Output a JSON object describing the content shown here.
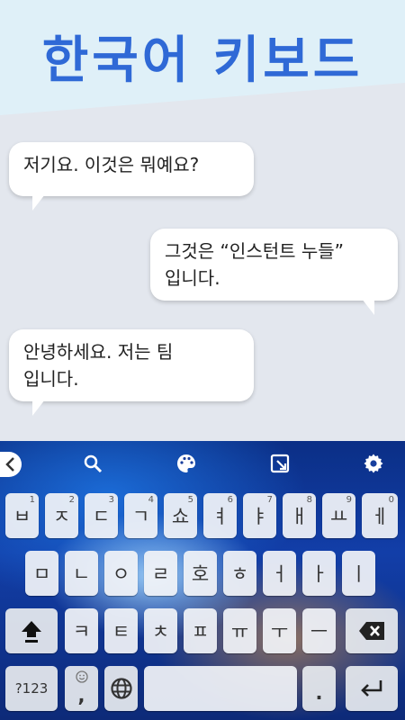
{
  "banner": {
    "title": "한국어 키보드"
  },
  "chat": {
    "messages": [
      {
        "line1": "저기요. 이것은 뭐예요?",
        "line2": ""
      },
      {
        "line1": "그것은 “인스턴트 누들”",
        "line2": "입니다."
      },
      {
        "line1": "안녕하세요. 저는 팀",
        "line2": "입니다."
      }
    ]
  },
  "toolbar": {
    "icons": [
      "back-chevron-icon",
      "search-icon",
      "palette-icon",
      "resize-icon",
      "gear-icon"
    ]
  },
  "keyboard": {
    "row1": [
      {
        "label": "ㅂ",
        "num": "1"
      },
      {
        "label": "ㅈ",
        "num": "2"
      },
      {
        "label": "ㄷ",
        "num": "3"
      },
      {
        "label": "ㄱ",
        "num": "4"
      },
      {
        "label": "쇼",
        "num": "5"
      },
      {
        "label": "ㅕ",
        "num": "6"
      },
      {
        "label": "ㅑ",
        "num": "7"
      },
      {
        "label": "ㅐ",
        "num": "8"
      },
      {
        "label": "ㅛ",
        "num": "9"
      },
      {
        "label": "ㅔ",
        "num": "0"
      }
    ],
    "row2": [
      "ㅁ",
      "ㄴ",
      "ㅇ",
      "ㄹ",
      "호",
      "ㅎ",
      "ㅓ",
      "ㅏ",
      "ㅣ"
    ],
    "row3": [
      "ㅋ",
      "ㅌ",
      "ㅊ",
      "ㅍ",
      "ㅠ",
      "ㅜ",
      "ㅡ"
    ],
    "symbols_label": "?123",
    "comma_label": ",",
    "period_label": "."
  }
}
